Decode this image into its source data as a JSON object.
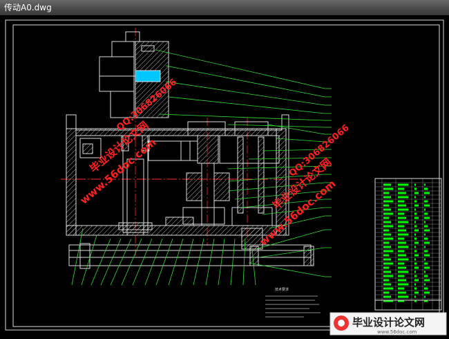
{
  "window": {
    "title": "传动A0.dwg"
  },
  "watermarks": {
    "site_left": "www.56doc.com",
    "qq_left": "QQ:306826066",
    "brand_left": "毕业设计论文网",
    "site_right": "www.56doc.com",
    "qq_right": "QQ:306826066",
    "brand_right": "毕业设计论文网"
  },
  "logo": {
    "name": "毕业设计论文网",
    "url": "www.56doc.com"
  },
  "notes": {
    "heading": "技术要求"
  },
  "colors": {
    "frame": "#ffffff",
    "outline": "#00ff00",
    "leader": "#33dd33",
    "centerline": "#ff2a2a",
    "hatch": "#ffffff",
    "table_text": "#00ff00",
    "watermark": "#ff2020"
  }
}
